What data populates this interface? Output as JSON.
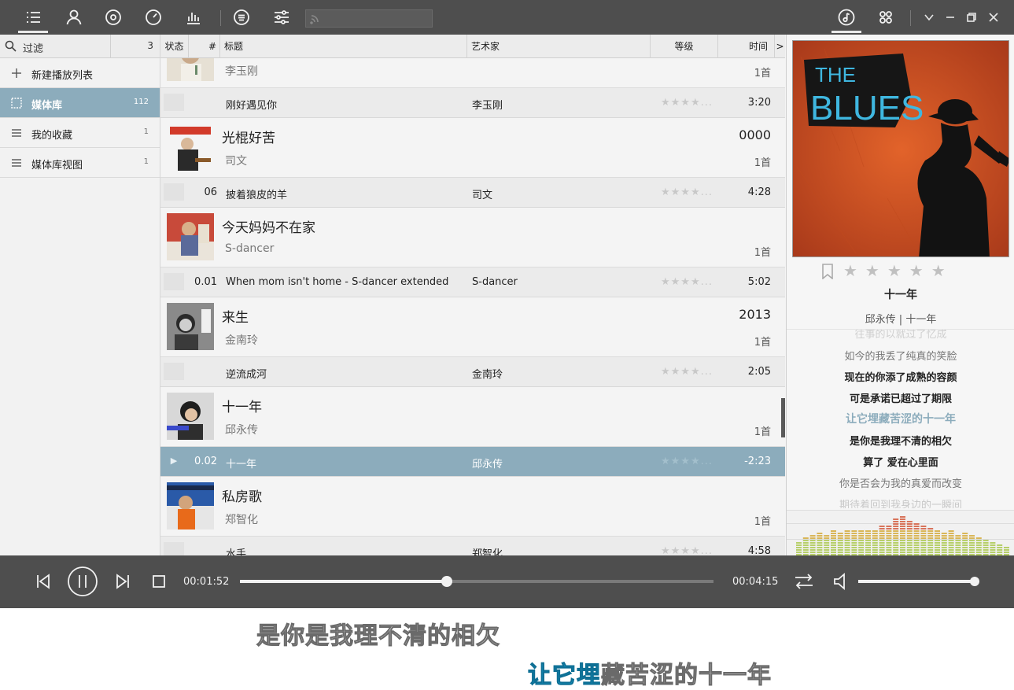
{
  "toolbar": {
    "buttons": [
      "playlist-icon",
      "user-icon",
      "disc-icon",
      "compass-icon",
      "equalizer-icon",
      "menu-circle-icon",
      "sliders-icon"
    ],
    "search_placeholder": "",
    "right_buttons": [
      "music-note-icon",
      "grid-icon"
    ]
  },
  "sidebar": {
    "filter_label": "过滤",
    "filter_count": "3",
    "items": [
      {
        "label": "新建播放列表",
        "count": "",
        "icon": "plus-icon"
      },
      {
        "label": "媒体库",
        "count": "112",
        "icon": "library-icon"
      },
      {
        "label": "我的收藏",
        "count": "1",
        "icon": "list-icon"
      },
      {
        "label": "媒体库视图",
        "count": "1",
        "icon": "list-icon"
      }
    ]
  },
  "list": {
    "columns": {
      "status": "状态",
      "num": "#",
      "title": "标题",
      "artist": "艺术家",
      "rating": "等级",
      "time": "时间",
      "more": ">"
    },
    "albums": [
      {
        "title": "",
        "artist": "李玉刚",
        "year": "",
        "count": "1首",
        "track": {
          "num": "",
          "title": "刚好遇见你",
          "artist": "李玉刚",
          "rating": "★★★★...",
          "time": "3:20"
        }
      },
      {
        "title": "光棍好苦",
        "artist": "司文",
        "year": "0000",
        "count": "1首",
        "track": {
          "num": "06",
          "title": "披着狼皮的羊",
          "artist": "司文",
          "rating": "★★★★...",
          "time": "4:28"
        }
      },
      {
        "title": "今天妈妈不在家",
        "artist": "S-dancer",
        "year": "",
        "count": "1首",
        "track": {
          "num": "0.01",
          "title": "When mom isn't home - S-dancer extended",
          "artist": "S-dancer",
          "rating": "★★★★...",
          "time": "5:02"
        }
      },
      {
        "title": "来生",
        "artist": "金南玲",
        "year": "2013",
        "count": "1首",
        "track": {
          "num": "",
          "title": "逆流成河",
          "artist": "金南玲",
          "rating": "★★★★...",
          "time": "2:05"
        }
      },
      {
        "title": "十一年",
        "artist": "邱永传",
        "year": "",
        "count": "1首",
        "track": {
          "num": "0.02",
          "title": "十一年",
          "artist": "邱永传",
          "rating": "★★★★...",
          "time": "-2:23",
          "status": "▶"
        }
      },
      {
        "title": "私房歌",
        "artist": "郑智化",
        "year": "",
        "count": "1首",
        "track": {
          "num": "",
          "title": "水手",
          "artist": "郑智化",
          "rating": "★★★★...",
          "time": "4:58"
        }
      }
    ]
  },
  "now_playing": {
    "art_text_top": "THE",
    "art_text_main": "BLUES",
    "rating": "★★★★★",
    "title": "十一年",
    "subtitle": "邱永传 | 十一年",
    "lyrics": [
      "往事的以就过了忆成",
      "如今的我丢了纯真的笑脸",
      "现在的你添了成熟的容颜",
      "可是承诺已超过了期限",
      "让它埋藏苦涩的十一年",
      "是你是我理不清的相欠",
      "算了 爱在心里面",
      "你是否会为我的真爱而改变",
      "期待着回到我身边的一瞬间"
    ],
    "current_lyric_index": 4,
    "spectrum_levels": [
      0.35,
      0.45,
      0.5,
      0.55,
      0.5,
      0.6,
      0.55,
      0.6,
      0.62,
      0.58,
      0.6,
      0.62,
      0.7,
      0.72,
      0.85,
      0.88,
      0.82,
      0.75,
      0.7,
      0.65,
      0.6,
      0.55,
      0.6,
      0.5,
      0.55,
      0.5,
      0.45,
      0.4,
      0.35,
      0.3,
      0.25
    ]
  },
  "player": {
    "elapsed": "00:01:52",
    "total": "00:04:15",
    "progress": 0.437,
    "volume": 1.0
  },
  "desktop_lyrics": {
    "line1": "是你是我理不清的相欠",
    "line2_sung": "让它埋",
    "line2_rest": "藏苦涩的十一年"
  },
  "colors": {
    "accent_selected": "#8cacbc",
    "toolbar_bg": "#4e4e4e",
    "lyric_highlight": "#8cacbc",
    "desktop_lyric_sung": "#1aa3d6"
  }
}
